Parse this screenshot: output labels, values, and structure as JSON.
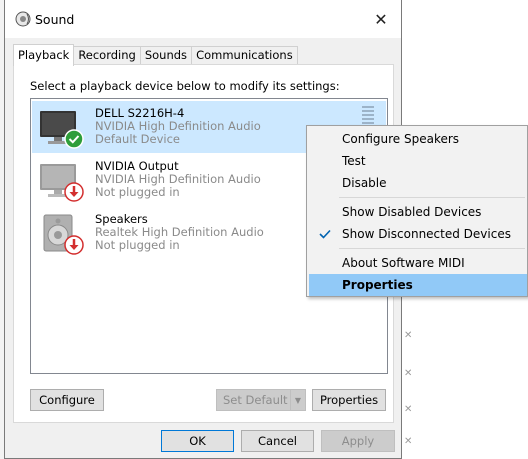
{
  "window": {
    "title": "Sound",
    "close_symbol": "✕"
  },
  "tabs": [
    {
      "label": "Playback",
      "active": true
    },
    {
      "label": "Recording",
      "active": false
    },
    {
      "label": "Sounds",
      "active": false
    },
    {
      "label": "Communications",
      "active": false
    }
  ],
  "playback": {
    "instruction": "Select a playback device below to modify its settings:",
    "devices": [
      {
        "name": "DELL S2216H-4",
        "driver": "NVIDIA High Definition Audio",
        "status": "Default Device",
        "icon": "monitor-icon",
        "badge": "green-check-icon",
        "selected": true
      },
      {
        "name": "NVIDIA Output",
        "driver": "NVIDIA High Definition Audio",
        "status": "Not plugged in",
        "icon": "monitor-icon",
        "badge": "red-down-arrow-icon",
        "selected": false
      },
      {
        "name": "Speakers",
        "driver": "Realtek High Definition Audio",
        "status": "Not plugged in",
        "icon": "speaker-icon",
        "badge": "red-down-arrow-icon",
        "selected": false
      }
    ],
    "buttons": {
      "configure": "Configure",
      "set_default": "Set Default",
      "properties": "Properties"
    }
  },
  "dialog_buttons": {
    "ok": "OK",
    "cancel": "Cancel",
    "apply": "Apply"
  },
  "context_menu": {
    "items": [
      {
        "label": "Configure Speakers",
        "checked": false,
        "highlighted": false
      },
      {
        "label": "Test",
        "checked": false,
        "highlighted": false
      },
      {
        "label": "Disable",
        "checked": false,
        "highlighted": false
      },
      {
        "label": "Show Disabled Devices",
        "checked": false,
        "highlighted": false
      },
      {
        "label": "Show Disconnected Devices",
        "checked": true,
        "highlighted": false
      },
      {
        "label": "About Software MIDI Synthesizer",
        "checked": false,
        "highlighted": false
      },
      {
        "label": "Properties",
        "checked": false,
        "highlighted": true
      }
    ]
  },
  "colors": {
    "selection": "#cce8ff",
    "menu_highlight": "#91c9f7",
    "accent": "#0078d7",
    "check_green": "#2e9e3a",
    "arrow_red": "#d32f2f"
  }
}
